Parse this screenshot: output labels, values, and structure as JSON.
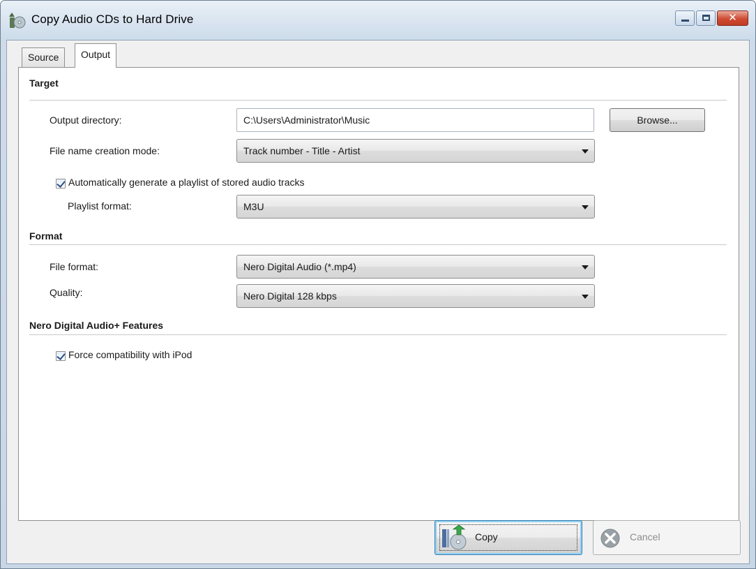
{
  "window": {
    "title": "Copy Audio CDs to Hard Drive",
    "controls": {
      "minimize": "minimize-icon",
      "maximize": "maximize-icon",
      "close": "close-icon"
    },
    "close_glyph": "✕"
  },
  "tabs": [
    {
      "label": "Source",
      "active": false
    },
    {
      "label": "Output",
      "active": true
    }
  ],
  "sections": {
    "target": {
      "title": "Target",
      "output_directory_label": "Output directory:",
      "output_directory_value": "C:\\Users\\Administrator\\Music",
      "browse_label": "Browse...",
      "file_name_mode_label": "File name creation mode:",
      "file_name_mode_value": "Track number - Title - Artist",
      "playlist_checkbox_label": "Automatically generate a playlist of stored audio tracks",
      "playlist_checkbox_checked": true,
      "playlist_format_label": "Playlist format:",
      "playlist_format_value": "M3U"
    },
    "format": {
      "title": "Format",
      "file_format_label": "File format:",
      "file_format_value": "Nero Digital Audio (*.mp4)",
      "quality_label": "Quality:",
      "quality_value": "Nero Digital 128 kbps"
    },
    "nero_features": {
      "title": "Nero Digital Audio+ Features",
      "ipod_checkbox_label": "Force compatibility with iPod",
      "ipod_checkbox_checked": true
    }
  },
  "footer": {
    "copy_label": "Copy",
    "cancel_label": "Cancel",
    "cancel_enabled": false
  },
  "colors": {
    "accent": "#3c7fb1",
    "close_button": "#cf4b32",
    "copy_arrow": "#3aa84a"
  }
}
